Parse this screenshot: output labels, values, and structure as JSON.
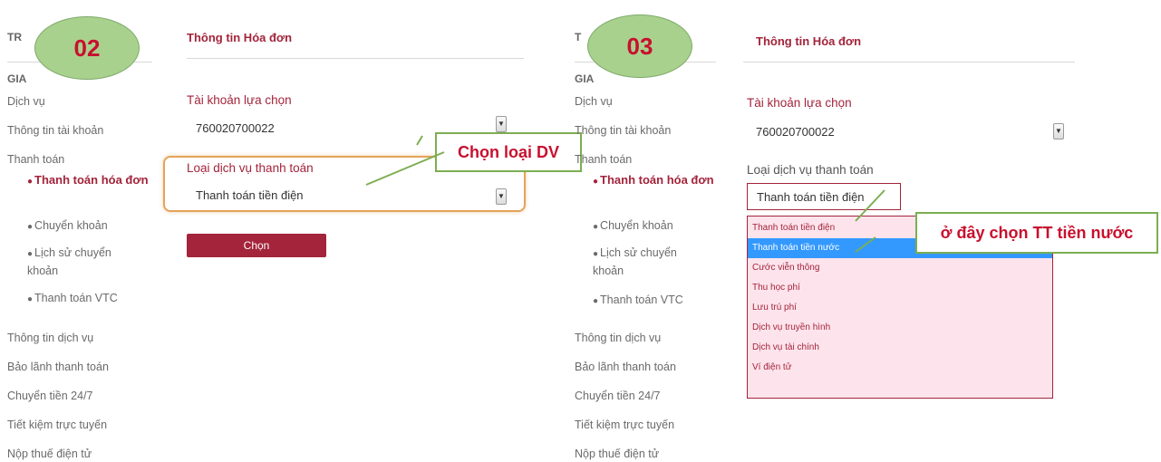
{
  "left": {
    "badge": "02",
    "sidebar_head_partial": "TR",
    "sidebar_sub_head": "GIA",
    "sidebar": [
      "Dịch vụ",
      "Thông tin tài khoản",
      "Thanh toán"
    ],
    "sub_items": [
      "Thanh toán hóa đơn",
      "Chuyển khoản",
      "Lịch sử chuyển khoản",
      "Thanh toán VTC"
    ],
    "sidebar_bottom": [
      "Thông tin dịch vụ",
      "Bảo lãnh thanh toán",
      "Chuyển tiền 24/7",
      "Tiết kiệm trực tuyến",
      "Nộp thuế điện tử"
    ],
    "section_title": "Thông tin Hóa đơn",
    "account_label": "Tài khoản lựa chọn",
    "account_value": "760020700022",
    "service_label": "Loại dịch vụ thanh toán",
    "service_value": "Thanh toán tiền điện",
    "submit_label": "Chọn",
    "callout": "Chọn loại DV"
  },
  "right": {
    "badge": "03",
    "sidebar_head_partial": "T",
    "sidebar_sub_head": "GIA",
    "sidebar": [
      "Dịch vụ",
      "Thông tin tài khoản",
      "Thanh toán"
    ],
    "sub_items": [
      "Thanh toán hóa đơn",
      "Chuyển khoản",
      "Lịch sử chuyển khoản",
      "Thanh toán VTC"
    ],
    "sidebar_bottom": [
      "Thông tin dịch vụ",
      "Bảo lãnh thanh toán",
      "Chuyển tiền 24/7",
      "Tiết kiệm trực tuyến",
      "Nộp thuế điện tử"
    ],
    "section_title": "Thông tin Hóa đơn",
    "account_label": "Tài khoản lựa chọn",
    "account_value": "760020700022",
    "service_label": "Loại dịch vụ thanh toán",
    "service_value": "Thanh toán tiền điện",
    "dropdown_options": [
      "Thanh toán tiền điện",
      "Thanh toán tiền nước",
      "Cước viễn thông",
      "Thu học phí",
      "Lưu trú phí",
      "Dịch vụ truyền hình",
      "Dịch vụ tài chính",
      "Ví điện tử"
    ],
    "selected_option": "Thanh toán tiền nước",
    "callout": "ở đây chọn TT tiền nước"
  },
  "colors": {
    "brand": "#a3243b",
    "badge_fill": "#a9d18e",
    "badge_text": "#c8102e",
    "selected": "#3399ff",
    "dropdown_bg": "#fde4ec"
  }
}
